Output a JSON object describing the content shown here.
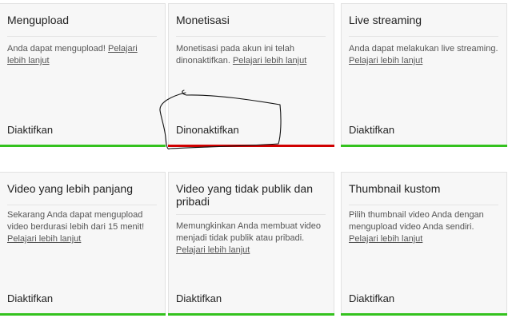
{
  "cards": [
    {
      "title": "Mengupload",
      "desc": "Anda dapat mengupload!",
      "link": "Pelajari lebih lanjut",
      "status": "Diaktifkan",
      "bar_color": "#34c21e"
    },
    {
      "title": "Monetisasi",
      "desc": "Monetisasi pada akun ini telah dinonaktifkan.",
      "link": "Pelajari lebih lanjut",
      "status": "Dinonaktifkan",
      "bar_color": "#d00000"
    },
    {
      "title": "Live streaming",
      "desc": "Anda dapat melakukan live streaming.",
      "link": "Pelajari lebih lanjut",
      "status": "Diaktifkan",
      "bar_color": "#34c21e"
    },
    {
      "title": "Video yang lebih panjang",
      "desc": "Sekarang Anda dapat mengupload video berdurasi lebih dari 15 menit!",
      "link": "Pelajari lebih lanjut",
      "status": "Diaktifkan",
      "bar_color": "#34c21e"
    },
    {
      "title": "Video yang tidak publik dan pribadi",
      "desc": "Memungkinkan Anda membuat video menjadi tidak publik atau pribadi.",
      "link": "Pelajari lebih lanjut",
      "status": "Diaktifkan",
      "bar_color": "#34c21e"
    },
    {
      "title": "Thumbnail kustom",
      "desc": "Pilih thumbnail video Anda dengan mengupload video Anda sendiri.",
      "link": "Pelajari lebih lanjut",
      "status": "Diaktifkan",
      "bar_color": "#34c21e"
    }
  ],
  "colors": {
    "enabled_bar": "#34c21e",
    "disabled_bar": "#d00000",
    "card_bg": "#f7f7f7"
  },
  "annotation": {
    "icon": "hand-drawn-circle-annotation"
  }
}
